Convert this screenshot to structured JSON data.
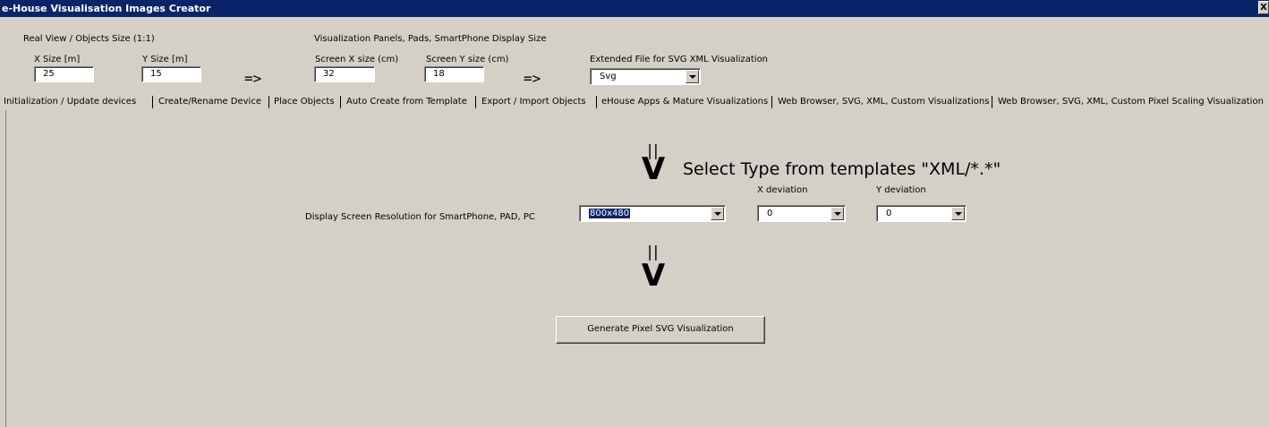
{
  "window": {
    "title": "e-House Visualisation Images Creator",
    "close_glyph": "X"
  },
  "real_view": {
    "heading": "Real View / Objects Size (1:1)",
    "x_label": "X Size [m]",
    "x_value": "25",
    "y_label": "Y Size [m]",
    "y_value": "15",
    "arrow": "=>"
  },
  "panels": {
    "heading": "Visualization Panels, Pads, SmartPhone Display Size",
    "x_label": "Screen X size (cm)",
    "x_value": "32",
    "y_label": "Screen Y size (cm)",
    "y_value": "18",
    "arrow": "=>"
  },
  "extended": {
    "label": "Extended File for SVG XML Visualization",
    "value": "Svg"
  },
  "tabs": [
    "Initialization / Update devices",
    "Create/Rename Device",
    "Place Objects",
    "Auto Create from Template",
    "Export / Import Objects",
    "eHouse Apps & Mature Visualizations",
    "Web Browser, SVG, XML, Custom Visualizations",
    "Web Browser, SVG, XML, Custom Pixel Scaling Visualization"
  ],
  "content": {
    "bars": "||",
    "v_glyph": "V",
    "select_text": "Select Type from templates \"XML/*.*\"",
    "resolution_label": "Display Screen Resolution for SmartPhone, PAD, PC",
    "resolution_value": "800x480",
    "x_dev_label": "X deviation",
    "x_dev_value": "0",
    "y_dev_label": "Y deviation",
    "y_dev_value": "0",
    "generate_label": "Generate  Pixel SVG Visualization"
  }
}
